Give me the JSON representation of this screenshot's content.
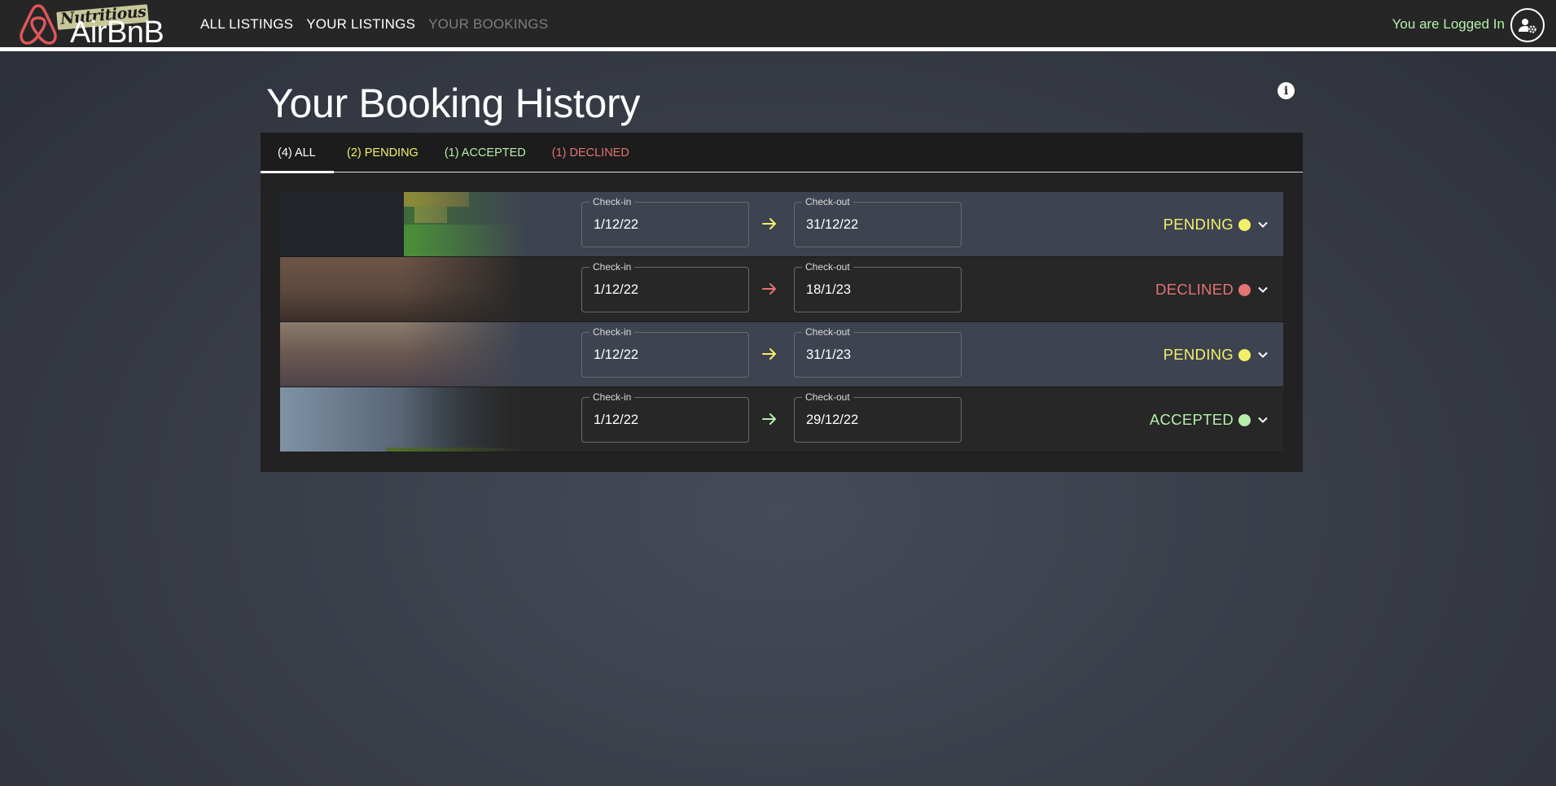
{
  "brand": {
    "script": "Nutritious",
    "name": "AirBnB",
    "logo_color": "#e0565b"
  },
  "nav": {
    "all_listings": "ALL LISTINGS",
    "your_listings": "YOUR LISTINGS",
    "your_bookings": "YOUR BOOKINGS",
    "login_text": "You are Logged In"
  },
  "page": {
    "title": "Your Booking History",
    "info_glyph": "i"
  },
  "tabs": [
    {
      "label": "(4) ALL",
      "color": "#ffffff",
      "active": true
    },
    {
      "label": "(2) PENDING",
      "color": "#f2f06a",
      "active": false
    },
    {
      "label": "(1) ACCEPTED",
      "color": "#b6eeab",
      "active": false
    },
    {
      "label": "(1) DECLINED",
      "color": "#e57373",
      "active": false
    }
  ],
  "bookings": [
    {
      "checkin_label": "Check-in",
      "checkin": "1/12/22",
      "checkout_label": "Check-out",
      "checkout": "31/12/22",
      "status": "PENDING",
      "status_color": "#f2f06a"
    },
    {
      "checkin_label": "Check-in",
      "checkin": "1/12/22",
      "checkout_label": "Check-out",
      "checkout": "18/1/23",
      "status": "DECLINED",
      "status_color": "#e57373"
    },
    {
      "checkin_label": "Check-in",
      "checkin": "1/12/22",
      "checkout_label": "Check-out",
      "checkout": "31/1/23",
      "status": "PENDING",
      "status_color": "#f2f06a"
    },
    {
      "checkin_label": "Check-in",
      "checkin": "1/12/22",
      "checkout_label": "Check-out",
      "checkout": "29/12/22",
      "status": "ACCEPTED",
      "status_color": "#b6eeab"
    }
  ]
}
